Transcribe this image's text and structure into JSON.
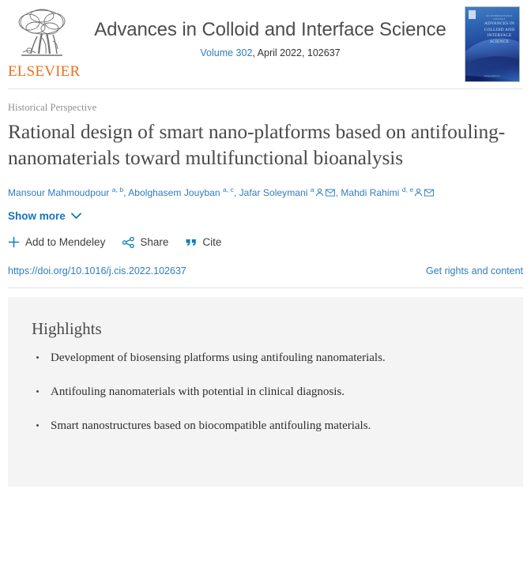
{
  "header": {
    "publisher_logo_text": "ELSEVIER",
    "publisher_logo_icon": "elsevier-tree-icon",
    "journal_title": "Advances in Colloid and Interface Science",
    "volume_link": "Volume 302",
    "issue_rest": ", April 2022, 102637",
    "cover_title_line1": "ADVANCES IN",
    "cover_title_line2": "COLLOID AND",
    "cover_title_line3": "INTERFACE",
    "cover_title_line4": "SCIENCE",
    "cover_sub": "AN INTERNATIONAL JOURNAL",
    "cover_footer": "ScienceDirect",
    "accent_blue": "#2e7cc0",
    "elsevier_orange": "#E9711C"
  },
  "article": {
    "doc_type": "Historical Perspective",
    "title": "Rational design of smart nano-platforms based on antifouling-nanomaterials toward multifunctional bioanalysis",
    "authors": [
      {
        "name": "Mansour Mahmoudpour",
        "affil": "a, b",
        "icons": []
      },
      {
        "name": "Abolghasem Jouyban",
        "affil": "a, c",
        "icons": []
      },
      {
        "name": "Jafar Soleymani",
        "affil": "a",
        "icons": [
          "person-icon",
          "envelope-icon"
        ]
      },
      {
        "name": "Mahdi Rahimi",
        "affil": "d, e",
        "icons": [
          "person-icon",
          "envelope-icon"
        ]
      }
    ],
    "show_more_label": "Show more",
    "show_more_icon": "chevron-down-icon",
    "actions": [
      {
        "label": "Add to Mendeley",
        "icon": "plus-icon"
      },
      {
        "label": "Share",
        "icon": "share-nodes-icon"
      },
      {
        "label": "Cite",
        "icon": "quote-icon"
      }
    ],
    "doi": "https://doi.org/10.1016/j.cis.2022.102637",
    "rights_label": "Get rights and content"
  },
  "highlights": {
    "title": "Highlights",
    "items": [
      "Development of biosensing platforms using antifouling nanomaterials.",
      "Antifouling nanomaterials with potential in clinical diagnosis.",
      "Smart nanostructures based on biocompatible antifouling materials."
    ]
  }
}
